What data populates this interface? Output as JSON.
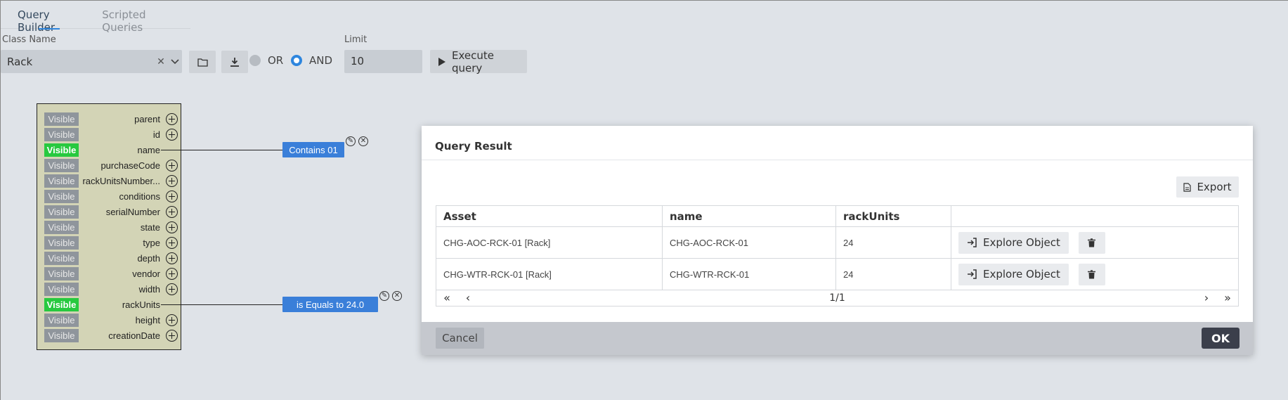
{
  "tabs": [
    "Query Builder",
    "Scripted Queries"
  ],
  "form": {
    "class_name_label": "Class Name",
    "class_name_value": "Rack",
    "or_label": "OR",
    "and_label": "AND",
    "limit_label": "Limit",
    "limit_value": "10",
    "execute_label": "Execute query",
    "logic_selected": "AND"
  },
  "fields": [
    {
      "vis": "Visible",
      "name": "parent",
      "on": false
    },
    {
      "vis": "Visible",
      "name": "id",
      "on": false
    },
    {
      "vis": "Visible",
      "name": "name",
      "on": true
    },
    {
      "vis": "Visible",
      "name": "purchaseCode",
      "on": false
    },
    {
      "vis": "Visible",
      "name": "rackUnitsNumber...",
      "on": false
    },
    {
      "vis": "Visible",
      "name": "conditions",
      "on": false
    },
    {
      "vis": "Visible",
      "name": "serialNumber",
      "on": false
    },
    {
      "vis": "Visible",
      "name": "state",
      "on": false
    },
    {
      "vis": "Visible",
      "name": "type",
      "on": false
    },
    {
      "vis": "Visible",
      "name": "depth",
      "on": false
    },
    {
      "vis": "Visible",
      "name": "vendor",
      "on": false
    },
    {
      "vis": "Visible",
      "name": "width",
      "on": false
    },
    {
      "vis": "Visible",
      "name": "rackUnits",
      "on": true
    },
    {
      "vis": "Visible",
      "name": "height",
      "on": false
    },
    {
      "vis": "Visible",
      "name": "creationDate",
      "on": false
    }
  ],
  "conditions": {
    "name_condition": "Contains 01",
    "rackunits_condition": "is Equals to 24.0"
  },
  "modal": {
    "title": "Query Result",
    "export_label": "Export",
    "columns": [
      "Asset",
      "name",
      "rackUnits",
      ""
    ],
    "rows": [
      {
        "asset": "CHG-AOC-RCK-01 [Rack]",
        "name": "CHG-AOC-RCK-01",
        "rackUnits": "24",
        "action": "Explore Object"
      },
      {
        "asset": "CHG-WTR-RCK-01 [Rack]",
        "name": "CHG-WTR-RCK-01",
        "rackUnits": "24",
        "action": "Explore Object"
      }
    ],
    "page": "1/1",
    "cancel_label": "Cancel",
    "ok_label": "OK"
  },
  "colors": {
    "accent": "#2e86de",
    "visible_on": "#27c93f",
    "condition": "#3a7fd9",
    "panel": "#d3d4b6"
  }
}
